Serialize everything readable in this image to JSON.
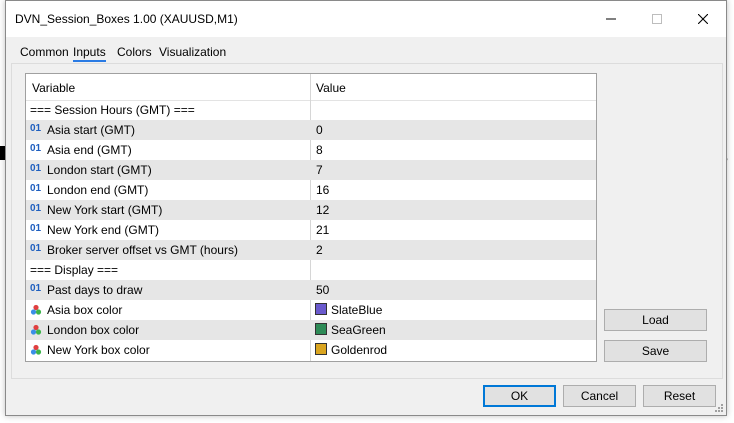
{
  "window": {
    "title": "DVN_Session_Boxes 1.00 (XAUUSD,M1)"
  },
  "tabs": [
    {
      "label": "Common"
    },
    {
      "label": "Inputs"
    },
    {
      "label": "Colors"
    },
    {
      "label": "Visualization"
    }
  ],
  "grid": {
    "col_variable": "Variable",
    "col_value": "Value",
    "rows": [
      {
        "name": "=== Session Hours (GMT) ===",
        "value": ""
      },
      {
        "name": "Asia start (GMT)",
        "value": "0",
        "icon": "01"
      },
      {
        "name": "Asia end (GMT)",
        "value": "8",
        "icon": "01"
      },
      {
        "name": "London start (GMT)",
        "value": "7",
        "icon": "01"
      },
      {
        "name": "London end (GMT)",
        "value": "16",
        "icon": "01"
      },
      {
        "name": "New York start (GMT)",
        "value": "12",
        "icon": "01"
      },
      {
        "name": "New York end (GMT)",
        "value": "21",
        "icon": "01"
      },
      {
        "name": "Broker server offset vs GMT (hours)",
        "value": "2",
        "icon": "01"
      },
      {
        "name": "=== Display ===",
        "value": ""
      },
      {
        "name": "Past days to draw",
        "value": "50",
        "icon": "01"
      },
      {
        "name": "Asia box color",
        "value": "SlateBlue",
        "color": "#6a5acd"
      },
      {
        "name": "London box color",
        "value": "SeaGreen",
        "color": "#2e8b57"
      },
      {
        "name": "New York box color",
        "value": "Goldenrod",
        "color": "#daa520"
      }
    ]
  },
  "buttons": {
    "load": "Load",
    "save": "Save",
    "ok": "OK",
    "cancel": "Cancel",
    "reset": "Reset"
  },
  "colors": {
    "accent": "#0078d7",
    "tab_underline": "#2a7be4",
    "icon_blue": "#1f5fbf"
  }
}
